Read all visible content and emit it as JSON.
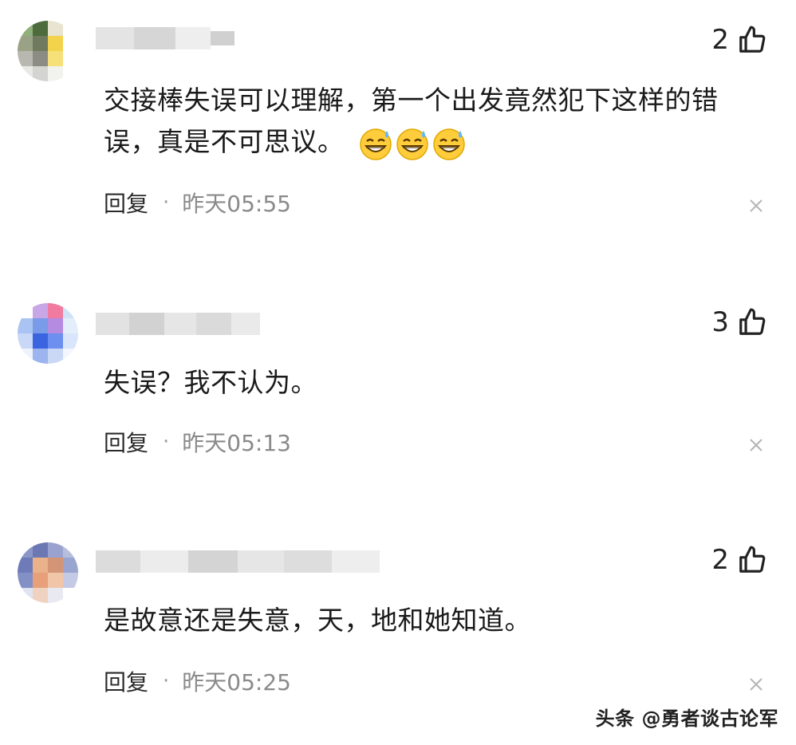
{
  "comments": [
    {
      "likes": "2",
      "text": "交接棒失误可以理解，第一个出发竟然犯下这样的错误，真是不可思议。",
      "emoji_icons": [
        "sweat-smile-emoji",
        "sweat-smile-emoji",
        "sweat-smile-emoji"
      ],
      "reply_label": "回复",
      "separator": "·",
      "time": "昨天05:55"
    },
    {
      "likes": "3",
      "text": "失误？我不认为。",
      "reply_label": "回复",
      "separator": "·",
      "time": "昨天05:13"
    },
    {
      "likes": "2",
      "text": "是故意还是失意，天，地和她知道。",
      "reply_label": "回复",
      "separator": "·",
      "time": "昨天05:25"
    }
  ],
  "watermark": "头条 @勇者谈古论军",
  "icons": {
    "like": "thumbs-up-icon",
    "dismiss": "close-icon"
  },
  "colors": {
    "text": "#1a1a1a",
    "time": "#8a8a8a",
    "background": "#ffffff"
  }
}
